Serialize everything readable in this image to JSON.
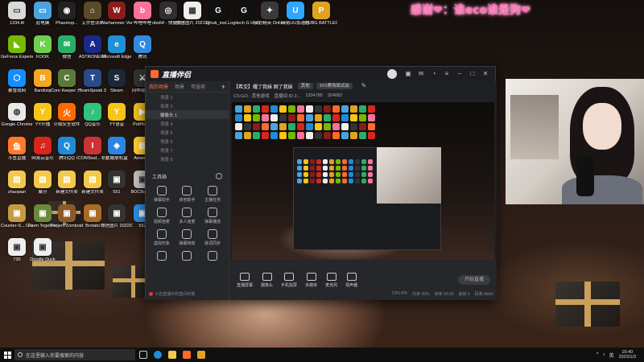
{
  "overlay_text": "感谢❤：谁eco谁是狗❤",
  "desktop": {
    "icons": [
      {
        "label": "1334.ltt",
        "color": "#d9d9d9",
        "glyph": "▭"
      },
      {
        "label": "此电脑",
        "color": "#4aa3df",
        "glyph": "▭"
      },
      {
        "label": "Phasmop...",
        "color": "#222222",
        "glyph": "◉"
      },
      {
        "label": "艾尔登法环",
        "color": "#5a4a2a",
        "glyph": "⌂"
      },
      {
        "label": "Warhammer Vermintide...",
        "color": "#8a1c1c",
        "glyph": "W"
      },
      {
        "label": "哔哩哔哩",
        "color": "#fb7299",
        "glyph": "b"
      },
      {
        "label": "obs64 - 快捷方式",
        "color": "#302e31",
        "glyph": "◎"
      },
      {
        "label": "微信图片 2021111...",
        "color": "#eeeeee",
        "glyph": "▦"
      },
      {
        "label": "lghub_inst...",
        "color": "#111111",
        "glyph": "G"
      },
      {
        "label": "Logitech G HUB",
        "color": "#111111",
        "glyph": "G"
      },
      {
        "label": "反恐精英 Online",
        "color": "#3a3a3a",
        "glyph": "✦"
      },
      {
        "label": "网易UU加速器",
        "color": "#2fa7ff",
        "glyph": "U"
      },
      {
        "label": "PUBG BATTLEGR...",
        "color": "#e0a21f",
        "glyph": "P"
      },
      {
        "label": "GeForce Experience",
        "color": "#76b900",
        "glyph": "◣"
      },
      {
        "label": "KOOK",
        "color": "#6ed04f",
        "glyph": "K"
      },
      {
        "label": "微信",
        "color": "#2aae67",
        "glyph": "✉"
      },
      {
        "label": "ASTRONEER",
        "color": "#1a2a8a",
        "glyph": "A"
      },
      {
        "label": "Microsoft Edge",
        "color": "#1f8fd6",
        "glyph": "e"
      },
      {
        "label": "腾讯",
        "color": "#2f8be0",
        "glyph": "Q"
      },
      {
        "label": "暴雪战网",
        "color": "#148eff",
        "glyph": "⬡"
      },
      {
        "label": "Bandizip",
        "color": "#f5a623",
        "glyph": "B"
      },
      {
        "label": "Core Keeper 开...",
        "color": "#5a7a3a",
        "glyph": "C"
      },
      {
        "label": "TeamSpeak 3",
        "color": "#2a4a8a",
        "glyph": "T"
      },
      {
        "label": "Steam",
        "color": "#1b2838",
        "glyph": "S"
      },
      {
        "label": "闪中现役 2",
        "color": "#333333",
        "glyph": "⚔"
      },
      {
        "label": "Google Chrome",
        "color": "#e9e9e9",
        "glyph": "◍"
      },
      {
        "label": "YY开播",
        "color": "#f5c518",
        "glyph": "Y"
      },
      {
        "label": "火绒安全软件",
        "color": "#ff6a00",
        "glyph": "火"
      },
      {
        "label": "QQ音乐",
        "color": "#31c27c",
        "glyph": "♪"
      },
      {
        "label": "YY语音",
        "color": "#f5c518",
        "glyph": "Y"
      },
      {
        "label": "PotPlayer",
        "color": "#f0c020",
        "glyph": "▶"
      },
      {
        "label": "斗鱼直播",
        "color": "#ff7a2a",
        "glyph": "鱼"
      },
      {
        "label": "网易云音乐",
        "color": "#d8261c",
        "glyph": "♫"
      },
      {
        "label": "腾讯QQ",
        "color": "#1f8bd8",
        "glyph": "Q"
      },
      {
        "label": "ICONStud... 机器",
        "color": "#cc3333",
        "glyph": "I"
      },
      {
        "label": "优酷联机盒",
        "color": "#2a86e0",
        "glyph": "◈"
      },
      {
        "label": "Avrenctg",
        "color": "#ffcc33",
        "glyph": "▤"
      },
      {
        "label": "zhaopian",
        "color": "#f2c94c",
        "glyph": "▤"
      },
      {
        "label": "聚分",
        "color": "#f2c94c",
        "glyph": "▤"
      },
      {
        "label": "新建文件夹",
        "color": "#f2c94c",
        "glyph": "▤"
      },
      {
        "label": "新建文件夹",
        "color": "#f2c94c",
        "glyph": "▤"
      },
      {
        "label": "551",
        "color": "#333333",
        "glyph": "▣"
      },
      {
        "label": "BOCBank...",
        "color": "#c0c0c0",
        "glyph": "▣"
      },
      {
        "label": "Counter-S... Global Off...",
        "color": "#c89a40",
        "glyph": "▣"
      },
      {
        "label": "Farm Together",
        "color": "#6a8a3a",
        "glyph": "▣"
      },
      {
        "label": "Project Zomboid",
        "color": "#8a5a2a",
        "glyph": "▣"
      },
      {
        "label": "Brotato",
        "color": "#aa6a2a",
        "glyph": "▣"
      },
      {
        "label": "微信图片 2022011...",
        "color": "#333333",
        "glyph": "▣"
      },
      {
        "label": "552",
        "color": "#2f8be0",
        "glyph": "▣"
      },
      {
        "label": "730",
        "color": "#eeeeee",
        "glyph": "▣"
      },
      {
        "label": "Doodle Duck",
        "color": "#eeeeee",
        "glyph": "▣"
      }
    ]
  },
  "app": {
    "title": "直播伴侣",
    "scene_tabs": [
      "我的场景",
      "场景",
      "可选项"
    ],
    "scene_add": "+",
    "scenes": [
      "场景 1",
      "场景 2",
      "摄像头 1",
      "场景 4",
      "场景 5",
      "场景 6",
      "场景 7",
      "场景 8"
    ],
    "toolbox_title": "工具箱",
    "tools": [
      "弹幕助手",
      "房管助手",
      "主播任务",
      "视频连麦",
      "多人连麦",
      "弹幕播放",
      "虚拟形象",
      "弹幕特效",
      "歌词同步",
      "",
      "",
      ""
    ],
    "status_left": "3.名直播中的直间伴报",
    "room_title": "【希交】耀了我妹 困了我妹",
    "chips": [
      "其他",
      "1V1赛场面试会"
    ],
    "meta": [
      "CS:GO - 其他游戏",
      "直播间 ID 2...",
      "1334785",
      "324082"
    ],
    "bottom_actions": [
      "直播屏幕",
      "摄像头",
      "手机投屏",
      "多媒体",
      "麦克风",
      "扬声器"
    ],
    "start_live": "开始直播",
    "status_right": [
      "CPU:8%",
      "内存 43%",
      "帧率 60.00",
      "丢帧 0",
      "码率 0kb/s"
    ]
  },
  "taskbar": {
    "search_placeholder": "在这里输入你要搜索的内容",
    "tray": [
      "^",
      "♪",
      "英"
    ],
    "time": "16:40",
    "date": "2023/1/3"
  }
}
